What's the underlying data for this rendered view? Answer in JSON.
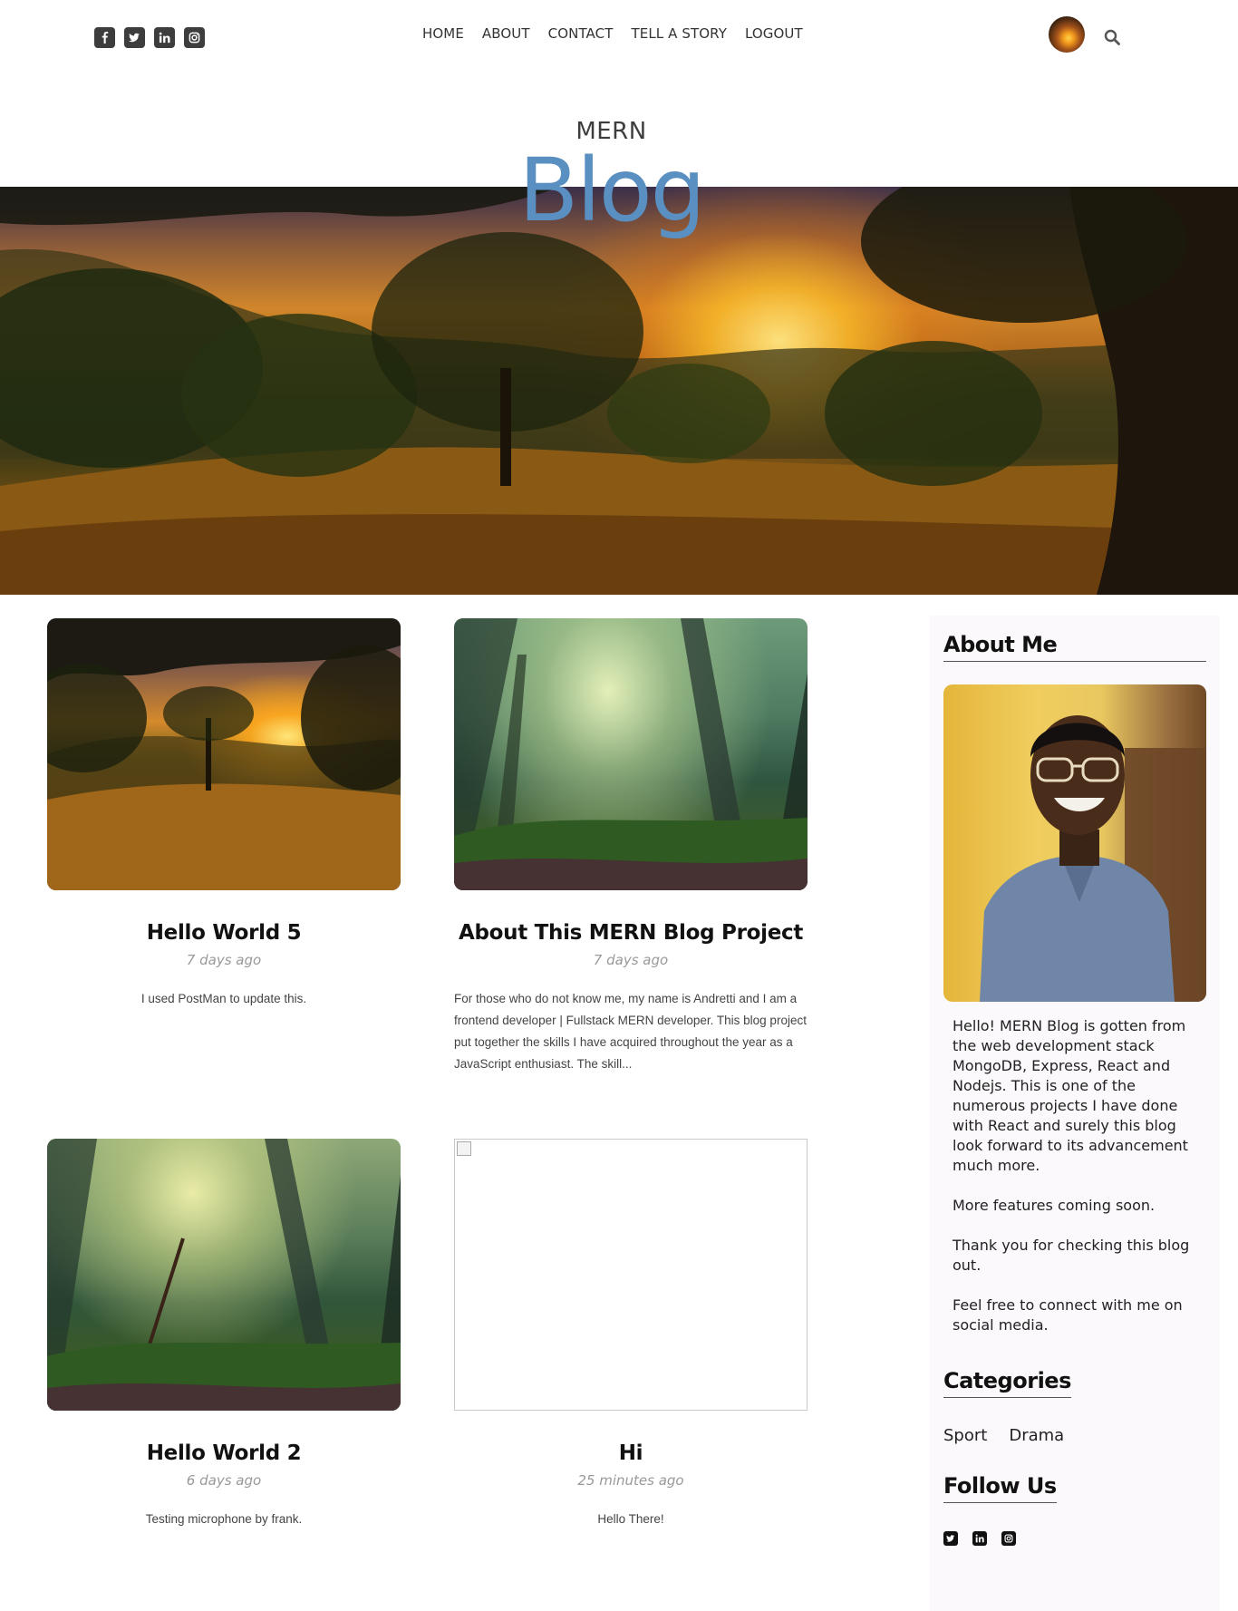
{
  "nav": {
    "items": [
      "HOME",
      "ABOUT",
      "CONTACT",
      "TELL A STORY",
      "LOGOUT"
    ]
  },
  "social": {
    "icons": [
      "facebook-icon",
      "twitter-icon",
      "linkedin-icon",
      "instagram-icon"
    ]
  },
  "header": {
    "small_title": "MERN",
    "big_title": "Blog"
  },
  "posts": [
    {
      "title": "Hello World 5",
      "time": "7 days ago",
      "excerpt": "I used PostMan to update this.",
      "image": "sunset"
    },
    {
      "title": "About This MERN Blog Project",
      "time": "7 days ago",
      "excerpt": "For those who do not know me, my name is Andretti and I am a frontend developer | Fullstack MERN developer. This blog project put together the skills I have acquired throughout the year as a JavaScript enthusiast. The skill...",
      "image": "forest"
    },
    {
      "title": "Hello World 2",
      "time": "6 days ago",
      "excerpt": "Testing microphone by frank.",
      "image": "forest"
    },
    {
      "title": "Hi",
      "time": "25 minutes ago",
      "excerpt": "Hello There!",
      "image": "broken"
    }
  ],
  "sidebar": {
    "about_heading": "About Me",
    "about_paragraphs": [
      "Hello! MERN Blog is gotten from the web development stack MongoDB, Express, React and Nodejs. This is one of the numerous projects I have done with React and surely this blog look forward to its advancement much more.",
      "More features coming soon.",
      "Thank you for checking this blog out.",
      "Feel free to connect with me on social media."
    ],
    "categories_heading": "Categories",
    "categories": [
      "Sport",
      "Drama"
    ],
    "follow_heading": "Follow Us",
    "follow_icons": [
      "twitter-icon",
      "linkedin-icon",
      "instagram-icon"
    ]
  },
  "colors": {
    "accent": "#5a8fc2",
    "text": "#111111",
    "muted": "#999999",
    "sidebar_bg": "#fbf9fb"
  }
}
